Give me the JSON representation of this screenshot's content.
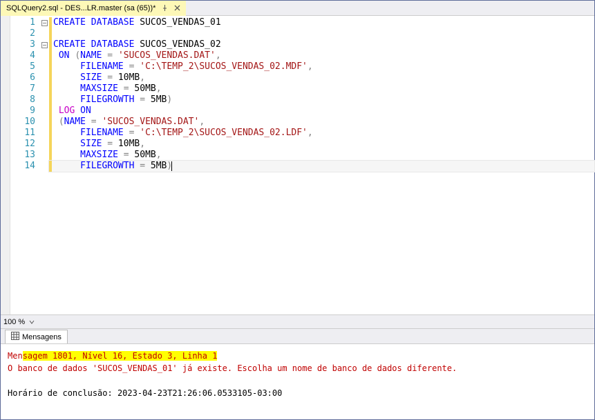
{
  "tab": {
    "title": "SQLQuery2.sql - DES...LR.master (sa (65))*"
  },
  "lines": [
    {
      "num": 1,
      "fold": true,
      "changed": true,
      "tokens": [
        {
          "cls": "kw-blue",
          "t": "CREATE"
        },
        {
          "cls": "plain",
          "t": " "
        },
        {
          "cls": "kw-blue",
          "t": "DATABASE"
        },
        {
          "cls": "plain",
          "t": " SUCOS_VENDAS_01"
        }
      ]
    },
    {
      "num": 2,
      "fold": false,
      "changed": true,
      "tokens": []
    },
    {
      "num": 3,
      "fold": true,
      "changed": true,
      "tokens": [
        {
          "cls": "kw-blue",
          "t": "CREATE"
        },
        {
          "cls": "plain",
          "t": " "
        },
        {
          "cls": "kw-blue",
          "t": "DATABASE"
        },
        {
          "cls": "plain",
          "t": " SUCOS_VENDAS_02"
        }
      ]
    },
    {
      "num": 4,
      "fold": false,
      "changed": true,
      "tokens": [
        {
          "cls": "plain",
          "t": " "
        },
        {
          "cls": "kw-blue",
          "t": "ON"
        },
        {
          "cls": "plain",
          "t": " "
        },
        {
          "cls": "kw-gray",
          "t": "("
        },
        {
          "cls": "kw-blue",
          "t": "NAME"
        },
        {
          "cls": "plain",
          "t": " "
        },
        {
          "cls": "kw-gray",
          "t": "="
        },
        {
          "cls": "plain",
          "t": " "
        },
        {
          "cls": "kw-red",
          "t": "'SUCOS_VENDAS.DAT'"
        },
        {
          "cls": "kw-gray",
          "t": ","
        }
      ]
    },
    {
      "num": 5,
      "fold": false,
      "changed": true,
      "tokens": [
        {
          "cls": "plain",
          "t": "     "
        },
        {
          "cls": "kw-blue",
          "t": "FILENAME"
        },
        {
          "cls": "plain",
          "t": " "
        },
        {
          "cls": "kw-gray",
          "t": "="
        },
        {
          "cls": "plain",
          "t": " "
        },
        {
          "cls": "kw-red",
          "t": "'C:\\TEMP_2\\SUCOS_VENDAS_02.MDF'"
        },
        {
          "cls": "kw-gray",
          "t": ","
        }
      ]
    },
    {
      "num": 6,
      "fold": false,
      "changed": true,
      "tokens": [
        {
          "cls": "plain",
          "t": "     "
        },
        {
          "cls": "kw-blue",
          "t": "SIZE"
        },
        {
          "cls": "plain",
          "t": " "
        },
        {
          "cls": "kw-gray",
          "t": "="
        },
        {
          "cls": "plain",
          "t": " 10MB"
        },
        {
          "cls": "kw-gray",
          "t": ","
        }
      ]
    },
    {
      "num": 7,
      "fold": false,
      "changed": true,
      "tokens": [
        {
          "cls": "plain",
          "t": "     "
        },
        {
          "cls": "kw-blue",
          "t": "MAXSIZE"
        },
        {
          "cls": "plain",
          "t": " "
        },
        {
          "cls": "kw-gray",
          "t": "="
        },
        {
          "cls": "plain",
          "t": " 50MB"
        },
        {
          "cls": "kw-gray",
          "t": ","
        }
      ]
    },
    {
      "num": 8,
      "fold": false,
      "changed": true,
      "tokens": [
        {
          "cls": "plain",
          "t": "     "
        },
        {
          "cls": "kw-blue",
          "t": "FILEGROWTH"
        },
        {
          "cls": "plain",
          "t": " "
        },
        {
          "cls": "kw-gray",
          "t": "="
        },
        {
          "cls": "plain",
          "t": " 5MB"
        },
        {
          "cls": "kw-gray",
          "t": ")"
        }
      ]
    },
    {
      "num": 9,
      "fold": false,
      "changed": true,
      "tokens": [
        {
          "cls": "plain",
          "t": " "
        },
        {
          "cls": "kw-magenta",
          "t": "LOG"
        },
        {
          "cls": "plain",
          "t": " "
        },
        {
          "cls": "kw-blue",
          "t": "ON"
        }
      ]
    },
    {
      "num": 10,
      "fold": false,
      "changed": true,
      "tokens": [
        {
          "cls": "plain",
          "t": " "
        },
        {
          "cls": "kw-gray",
          "t": "("
        },
        {
          "cls": "kw-blue",
          "t": "NAME"
        },
        {
          "cls": "plain",
          "t": " "
        },
        {
          "cls": "kw-gray",
          "t": "="
        },
        {
          "cls": "plain",
          "t": " "
        },
        {
          "cls": "kw-red",
          "t": "'SUCOS_VENDAS.DAT'"
        },
        {
          "cls": "kw-gray",
          "t": ","
        }
      ]
    },
    {
      "num": 11,
      "fold": false,
      "changed": true,
      "tokens": [
        {
          "cls": "plain",
          "t": "     "
        },
        {
          "cls": "kw-blue",
          "t": "FILENAME"
        },
        {
          "cls": "plain",
          "t": " "
        },
        {
          "cls": "kw-gray",
          "t": "="
        },
        {
          "cls": "plain",
          "t": " "
        },
        {
          "cls": "kw-red",
          "t": "'C:\\TEMP_2\\SUCOS_VENDAS_02.LDF'"
        },
        {
          "cls": "kw-gray",
          "t": ","
        }
      ]
    },
    {
      "num": 12,
      "fold": false,
      "changed": true,
      "tokens": [
        {
          "cls": "plain",
          "t": "     "
        },
        {
          "cls": "kw-blue",
          "t": "SIZE"
        },
        {
          "cls": "plain",
          "t": " "
        },
        {
          "cls": "kw-gray",
          "t": "="
        },
        {
          "cls": "plain",
          "t": " 10MB"
        },
        {
          "cls": "kw-gray",
          "t": ","
        }
      ]
    },
    {
      "num": 13,
      "fold": false,
      "changed": true,
      "tokens": [
        {
          "cls": "plain",
          "t": "     "
        },
        {
          "cls": "kw-blue",
          "t": "MAXSIZE"
        },
        {
          "cls": "plain",
          "t": " "
        },
        {
          "cls": "kw-gray",
          "t": "="
        },
        {
          "cls": "plain",
          "t": " 50MB"
        },
        {
          "cls": "kw-gray",
          "t": ","
        }
      ]
    },
    {
      "num": 14,
      "fold": false,
      "changed": true,
      "active": true,
      "tokens": [
        {
          "cls": "plain",
          "t": "     "
        },
        {
          "cls": "kw-blue",
          "t": "FILEGROWTH"
        },
        {
          "cls": "plain",
          "t": " "
        },
        {
          "cls": "kw-gray",
          "t": "="
        },
        {
          "cls": "plain",
          "t": " 5MB"
        },
        {
          "cls": "kw-gray",
          "t": ")"
        }
      ]
    }
  ],
  "zoom": {
    "value": "100 %"
  },
  "messages": {
    "tab_label": "Mensagens",
    "error_plain": "Men",
    "error_highlight": "sagem 1801, Nível 16, Estado 3, Linha 1",
    "error_detail": "O banco de dados 'SUCOS_VENDAS_01' já existe. Escolha um nome de banco de dados diferente.",
    "completion": "Horário de conclusão: 2023-04-23T21:26:06.0533105-03:00"
  }
}
